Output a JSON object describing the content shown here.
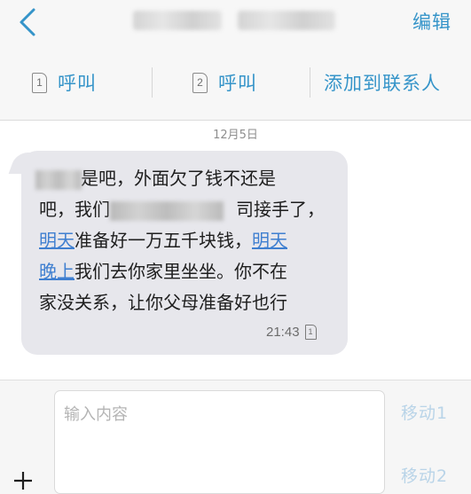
{
  "nav": {
    "edit_label": "编辑"
  },
  "actions": {
    "call1": {
      "sim": "1",
      "label": "呼叫"
    },
    "call2": {
      "sim": "2",
      "label": "呼叫"
    },
    "add_contact": "添加到联系人"
  },
  "thread": {
    "date": "12月5日",
    "message": {
      "lines": [
        {
          "a": "是吧，外面欠了钱不还是"
        },
        {
          "a": "吧，我们",
          "b": "司接手了，"
        },
        {
          "link1": "明天",
          "mid": "准备好一万五千块钱，",
          "link2": "明天"
        },
        {
          "link1": "晚上",
          "mid": "我们去你家里坐坐。你不在"
        },
        {
          "a": "家没关系，让你父母准备好也行"
        }
      ],
      "time": "21:43",
      "sim": "1"
    }
  },
  "compose": {
    "placeholder": "输入内容",
    "send1": "移动1",
    "send2": "移动2"
  },
  "colors": {
    "accent": "#3594c9",
    "bubble": "#e7e7ec",
    "link": "#3f7fd0"
  }
}
